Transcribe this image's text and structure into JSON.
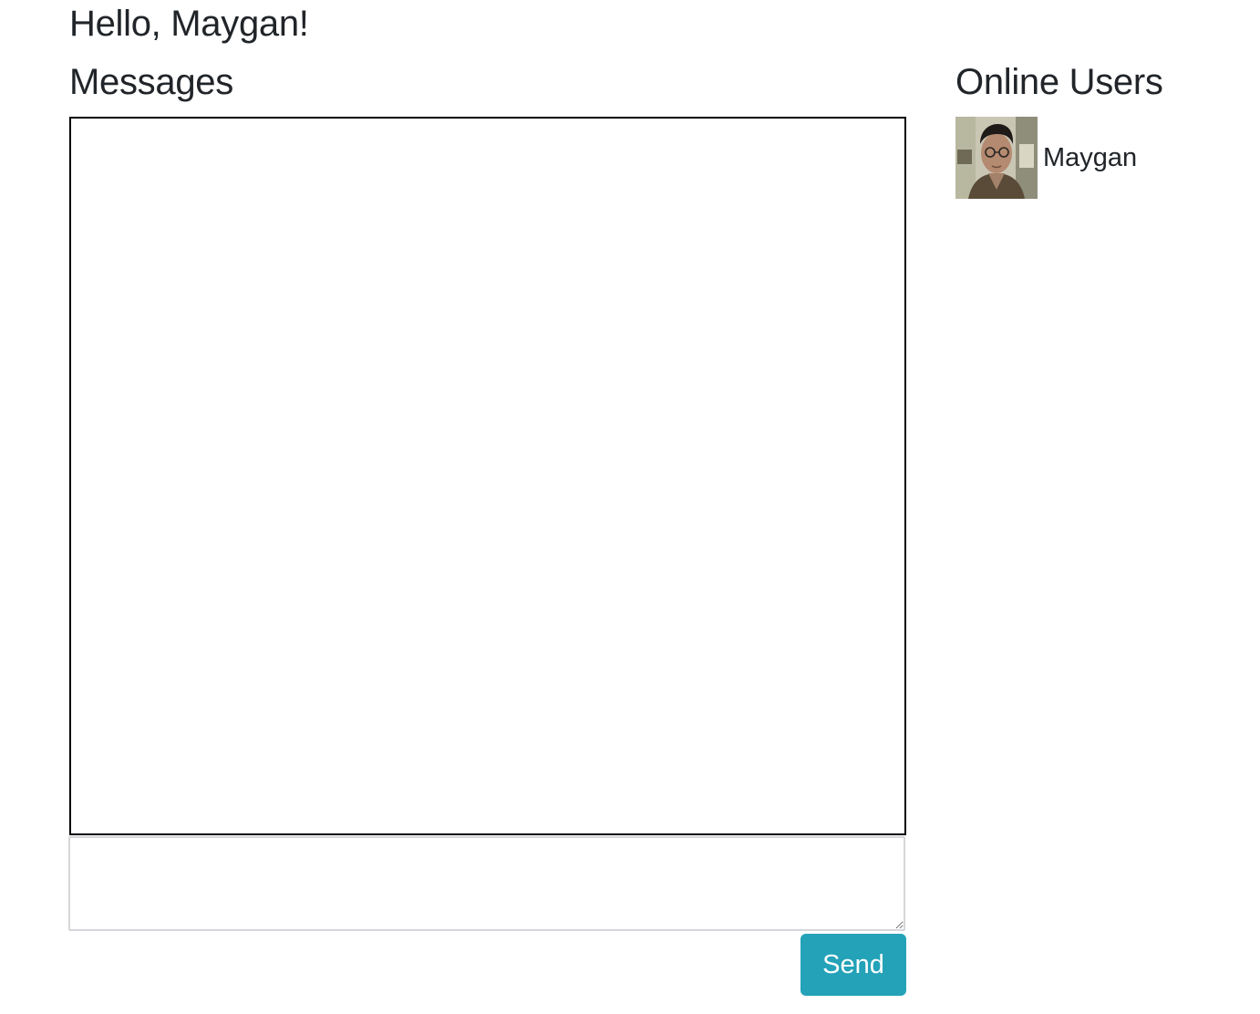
{
  "header": {
    "greeting": "Hello, Maygan!"
  },
  "messages": {
    "heading": "Messages",
    "items": [],
    "input_value": "",
    "send_label": "Send",
    "send_color": "#23a2b8"
  },
  "online_users": {
    "heading": "Online Users",
    "users": [
      {
        "name": "Maygan",
        "avatar_icon": "user-photo-avatar"
      }
    ]
  }
}
